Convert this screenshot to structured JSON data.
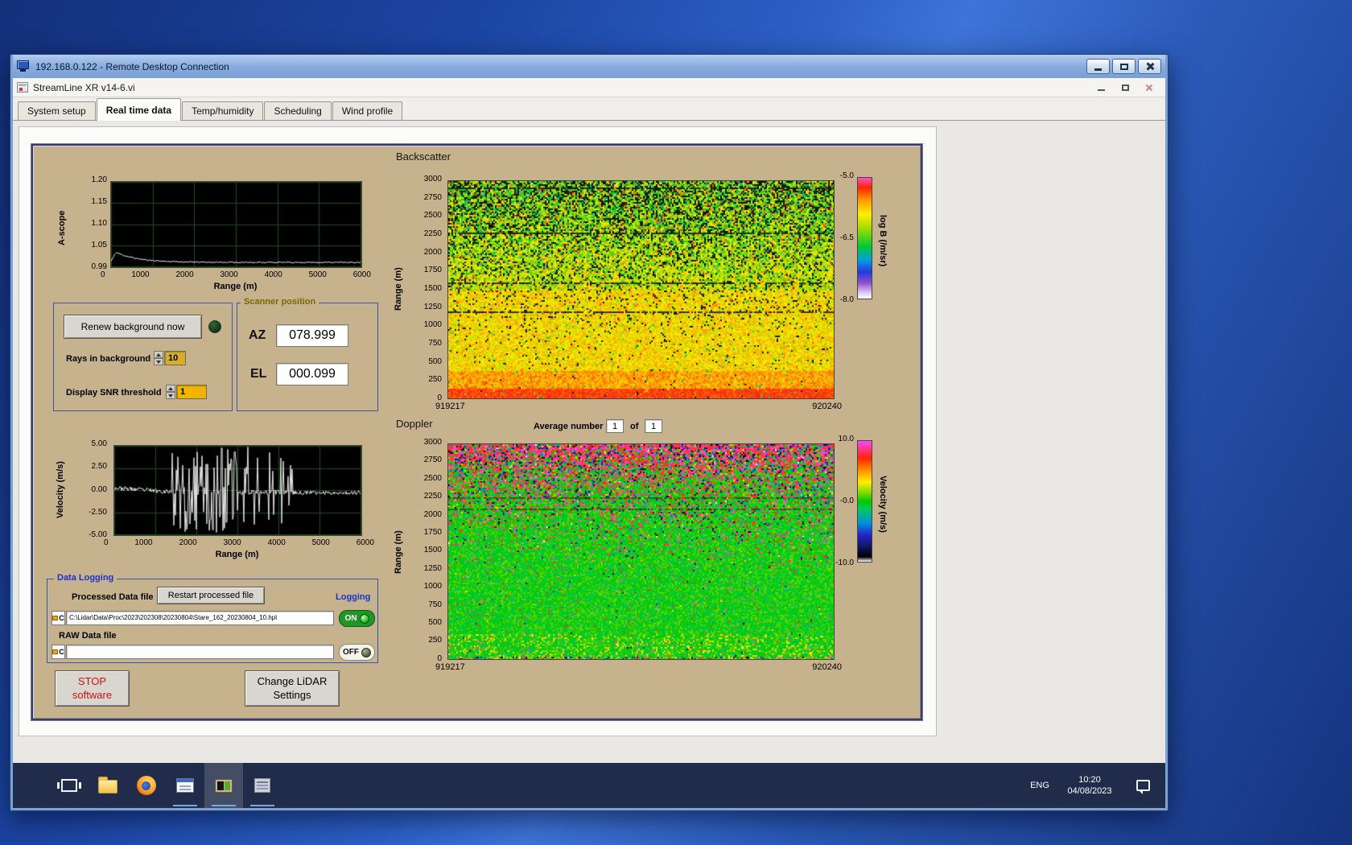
{
  "rdp_window": {
    "title": "192.168.0.122 - Remote Desktop Connection"
  },
  "app_window": {
    "title": "StreamLine XR v14-6.vi",
    "tabs": [
      {
        "label": "System setup"
      },
      {
        "label": "Real time data"
      },
      {
        "label": "Temp/humidity"
      },
      {
        "label": "Scheduling"
      },
      {
        "label": "Wind profile"
      }
    ]
  },
  "panel": {
    "background_group": {
      "renew_button": "Renew background now",
      "rays_label": "Rays in background",
      "rays_value": "10",
      "snr_label": "Display SNR threshold",
      "snr_value": "1"
    },
    "scanner": {
      "title": "Scanner position",
      "az_label": "AZ",
      "az_value": "078.999",
      "el_label": "EL",
      "el_value": "000.099"
    },
    "doppler_controls": {
      "average_label": "Average number",
      "average_value": "1",
      "of_label": "of",
      "average_total": "1"
    },
    "logging": {
      "group_title": "Data Logging",
      "processed_label": "Processed Data file",
      "restart_button": "Restart processed file",
      "logging_label": "Logging",
      "drive_label": "C",
      "processed_path": "C:\\Lidar\\Data\\Proc\\2023\\202308\\20230804\\Stare_162_20230804_10.hpl",
      "raw_label": "RAW Data file",
      "raw_path": "",
      "on_label": "ON",
      "off_label": "OFF"
    },
    "stop_button": {
      "line1": "STOP",
      "line2": "software"
    },
    "settings_button": {
      "line1": "Change LiDAR",
      "line2": "Settings"
    }
  },
  "taskbar": {
    "language": "ENG",
    "time": "10:20",
    "date": "04/08/2023"
  },
  "chart_data": [
    {
      "id": "ascope",
      "type": "line",
      "ylabel": "A-scope",
      "xlabel": "Range (m)",
      "xlim": [
        0,
        6000
      ],
      "ylim": [
        0.99,
        1.2
      ],
      "yticks": [
        "1.20",
        "1.15",
        "1.10",
        "1.05",
        "0.99"
      ],
      "xticks": [
        "0",
        "1000",
        "2000",
        "3000",
        "4000",
        "5000",
        "6000"
      ],
      "trace_note": "white trace rises to ~1.025 near 200 m then decays to ~1.00 by 1500 m and stays flat",
      "grid": true,
      "seed": 11
    },
    {
      "id": "velocity",
      "type": "line",
      "ylabel": "Velocity (m/s)",
      "xlabel": "Range (m)",
      "xlim": [
        0,
        6000
      ],
      "ylim": [
        -5,
        5
      ],
      "yticks": [
        "5.00",
        "2.50",
        "0.00",
        "-2.50",
        "-5.00"
      ],
      "xticks": [
        "0",
        "1000",
        "2000",
        "3000",
        "4000",
        "5000",
        "6000"
      ],
      "trace_note": "near-zero white trace with dense saturated spikes between ~1500 m and ~3000 m",
      "grid": true,
      "seed": 23
    },
    {
      "id": "backscatter",
      "type": "heatmap",
      "title": "Backscatter",
      "ylabel": "Range (m)",
      "yticks": [
        "3000",
        "2750",
        "2500",
        "2250",
        "2000",
        "1750",
        "1500",
        "1250",
        "1000",
        "750",
        "500",
        "250",
        "0"
      ],
      "x_start": "919217",
      "x_end": "920240",
      "value_range": [
        -8.0,
        -5.0
      ],
      "colorbar_label": "log B (/m/sr)",
      "colorbar_ticks": [
        "-5.0",
        "-6.5",
        "-8.0"
      ],
      "colormap": [
        [
          0.0,
          "#ffffff"
        ],
        [
          0.05,
          "#e0c4f0"
        ],
        [
          0.13,
          "#8c50cc"
        ],
        [
          0.22,
          "#2838dd"
        ],
        [
          0.32,
          "#00a0e0"
        ],
        [
          0.43,
          "#00c838"
        ],
        [
          0.58,
          "#a0dc00"
        ],
        [
          0.7,
          "#ffee00"
        ],
        [
          0.82,
          "#ff9400"
        ],
        [
          0.92,
          "#ff2400"
        ],
        [
          1.0,
          "#ff50c8"
        ]
      ],
      "content_note": "strong orange-red returns below ~500 m fading to noisy yellow-green speckle aloft with dark layer lines",
      "dark_rows": [
        0.4,
        0.53,
        0.76,
        0.97
      ],
      "seed": 7
    },
    {
      "id": "doppler",
      "type": "heatmap",
      "title": "Doppler",
      "ylabel": "Range (m)",
      "yticks": [
        "3000",
        "2750",
        "2500",
        "2250",
        "2000",
        "1750",
        "1500",
        "1250",
        "1000",
        "750",
        "500",
        "250",
        "0"
      ],
      "x_start": "919217",
      "x_end": "920240",
      "value_range": [
        -10.0,
        10.0
      ],
      "colorbar_label": "Velocity (m/s)",
      "colorbar_ticks": [
        "10.0",
        "-0.0",
        "-10.0"
      ],
      "colormap": [
        [
          0.0,
          "#ffffff"
        ],
        [
          0.04,
          "#000000"
        ],
        [
          0.13,
          "#14146a"
        ],
        [
          0.22,
          "#2424c8"
        ],
        [
          0.32,
          "#0090e0"
        ],
        [
          0.43,
          "#00c864"
        ],
        [
          0.5,
          "#00c800"
        ],
        [
          0.58,
          "#8cdc00"
        ],
        [
          0.66,
          "#ffee00"
        ],
        [
          0.76,
          "#ff8c00"
        ],
        [
          0.86,
          "#ff2400"
        ],
        [
          1.0,
          "#ff48ff"
        ]
      ],
      "content_note": "near-zero (green) velocities below ~1700 m, magenta/pink noise speckle dominating aloft",
      "dark_rows": [
        0.7,
        0.75
      ],
      "seed": 19
    }
  ]
}
